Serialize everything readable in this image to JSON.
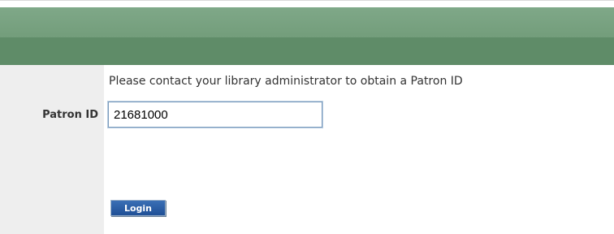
{
  "form": {
    "help_text": "Please contact your library administrator to obtain a Patron ID",
    "patron_label": "Patron ID",
    "patron_value": "21681000",
    "login_label": "Login"
  },
  "colors": {
    "header_top": "#7fa888",
    "header_bottom": "#5f8c68",
    "left_column": "#eeeeee",
    "button": "#2b5fa8"
  }
}
